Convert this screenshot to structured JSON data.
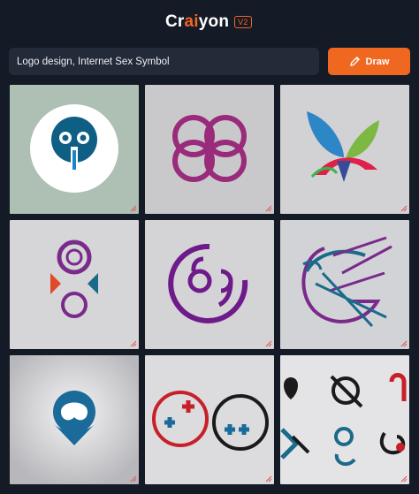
{
  "app": {
    "brand_prefix": "Cr",
    "brand_accent": "ai",
    "brand_suffix": "yon",
    "version": "V2"
  },
  "search": {
    "value": "Logo design, Internet Sex Symbol"
  },
  "toolbar": {
    "draw_label": "Draw",
    "draw_icon": "pencil-icon"
  },
  "colors": {
    "background": "#141a26",
    "accent": "#f26522",
    "input_bg": "#232a38",
    "button_bg": "#f06820"
  },
  "results": {
    "tiles": [
      {
        "subject": "blue skull-like face logo in white circle"
      },
      {
        "subject": "purple infinity double-ring logo"
      },
      {
        "subject": "colorful butterfly / leaf logo"
      },
      {
        "subject": "purple stacked circles figure logo"
      },
      {
        "subject": "purple number 69 in circle logo"
      },
      {
        "subject": "interlocking letter G lines logo"
      },
      {
        "subject": "blue droplet heart emblem logo"
      },
      {
        "subject": "two circles with plus signs"
      },
      {
        "subject": "grid of small black and teal symbols"
      }
    ],
    "corner_icon": "resize-corner-icon"
  }
}
